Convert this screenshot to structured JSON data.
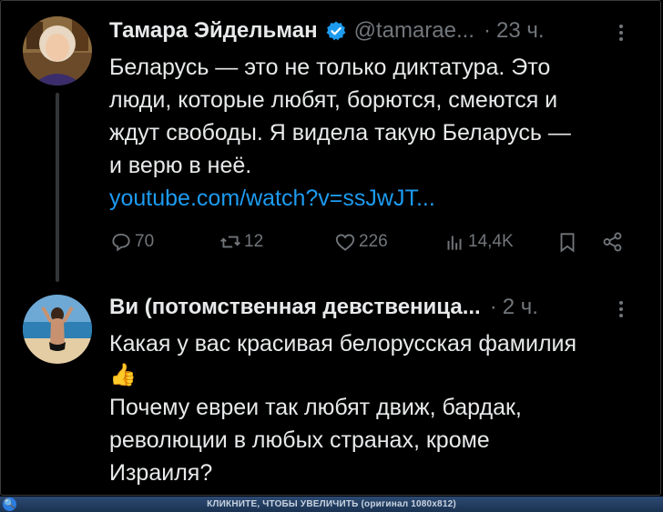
{
  "tweets": [
    {
      "name": "Тамара Эйдельман",
      "handle": "@tamarae...",
      "dot": "·",
      "time": "23 ч.",
      "lines": [
        "Беларусь — это не только диктатура.  Это",
        "люди, которые любят, борются, смеются и",
        "ждут свободы. Я видела такую Беларусь —",
        "и верю в неё."
      ],
      "link": "youtube.com/watch?v=ssJwJT...",
      "stats": {
        "replies": "70",
        "reposts": "12",
        "likes": "226",
        "views": "14,4K"
      }
    },
    {
      "name": "Ви (потомственная девственица...",
      "dot": "·",
      "time": "2 ч.",
      "lines": [
        "Какая у вас красивая белорусская фамилия"
      ],
      "emoji": "👍",
      "lines2": [
        "Почему евреи так любят движ, бардак,",
        "революции в любых странах, кроме",
        "Израиля?"
      ]
    }
  ],
  "footer": {
    "label": "КЛИКНИТЕ, ЧТОБЫ УВЕЛИЧИТЬ (оригинал 1080x812)",
    "icon": "🔍"
  },
  "colors": {
    "background": "#000000",
    "text": "#e7e9ea",
    "muted": "#71767b",
    "link": "#1d9bf0",
    "verified": "#1d9bf0"
  }
}
